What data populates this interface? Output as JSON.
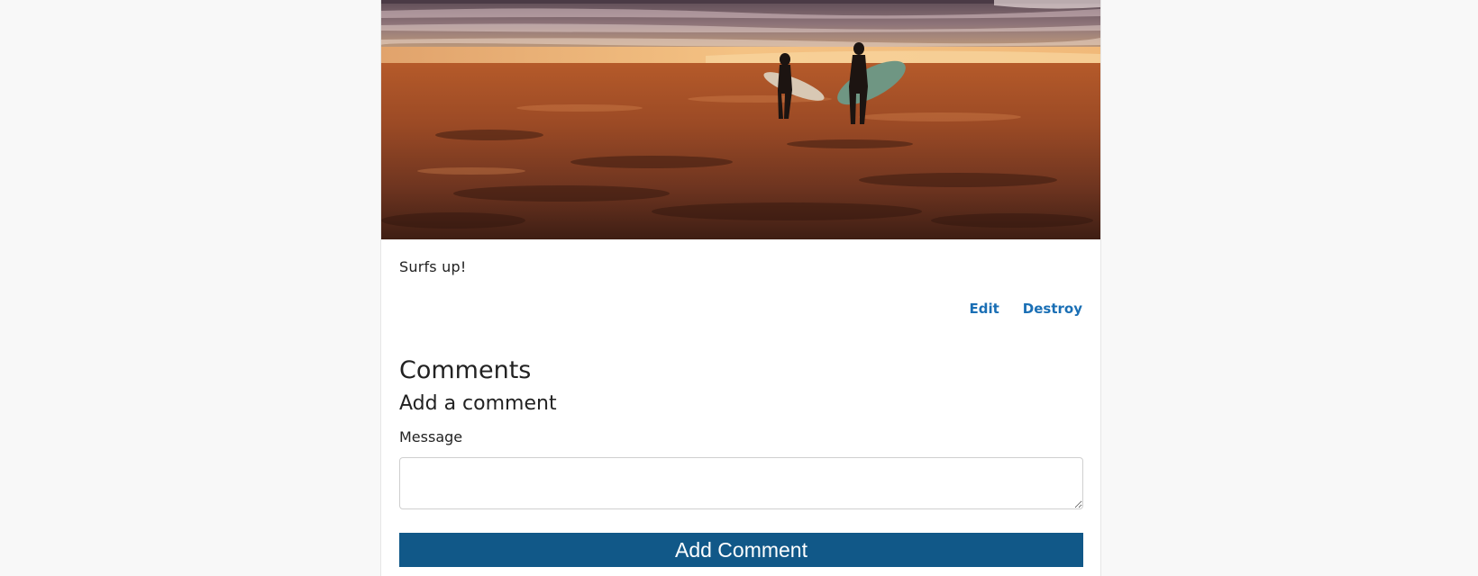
{
  "post": {
    "image_alt": "Two surfers walking on a beach at sunset",
    "caption": "Surfs up!",
    "actions": {
      "edit_label": "Edit",
      "destroy_label": "Destroy"
    }
  },
  "comments": {
    "title": "Comments",
    "form": {
      "title": "Add a comment",
      "message_label": "Message",
      "message_value": "",
      "submit_label": "Add Comment"
    }
  },
  "colors": {
    "link": "#1a6fb5",
    "button": "#115888",
    "page_background": "#f8f8f8"
  }
}
